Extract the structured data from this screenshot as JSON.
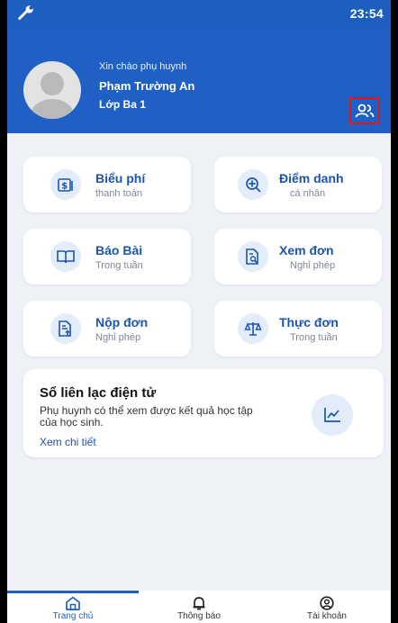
{
  "status_bar": {
    "time": "23:54"
  },
  "header": {
    "greeting": "Xin chào phụ huynh",
    "student_name": "Phạm Trường An",
    "class_name": "Lớp Ba 1"
  },
  "menu": [
    {
      "title": "Biểu phí",
      "subtitle": "thanh toán",
      "icon": "fee-icon"
    },
    {
      "title": "Điểm danh",
      "subtitle": "cá nhân",
      "icon": "attendance-icon"
    },
    {
      "title": "Báo Bài",
      "subtitle": "Trong tuần",
      "icon": "book-icon"
    },
    {
      "title": "Xem đơn",
      "subtitle": "Nghỉ phép",
      "icon": "view-document-icon"
    },
    {
      "title": "Nộp đơn",
      "subtitle": "Nghỉ phép",
      "icon": "submit-document-icon"
    },
    {
      "title": "Thực đơn",
      "subtitle": "Trong tuần",
      "icon": "scale-menu-icon"
    }
  ],
  "ebook": {
    "title": "Sổ liên lạc điện tử",
    "description": "Phụ huynh có thể xem được kết quả học tập của học sinh.",
    "link": "Xem chi tiết",
    "icon": "chart-line-icon"
  },
  "tabs": [
    {
      "label": "Trang chủ",
      "icon": "home-icon",
      "active": true
    },
    {
      "label": "Thông báo",
      "icon": "bell-icon",
      "active": false
    },
    {
      "label": "Tài khoản",
      "icon": "account-icon",
      "active": false
    }
  ],
  "colors": {
    "primary": "#2060c4",
    "highlight_border": "#e01818",
    "background": "#eef1f6"
  }
}
